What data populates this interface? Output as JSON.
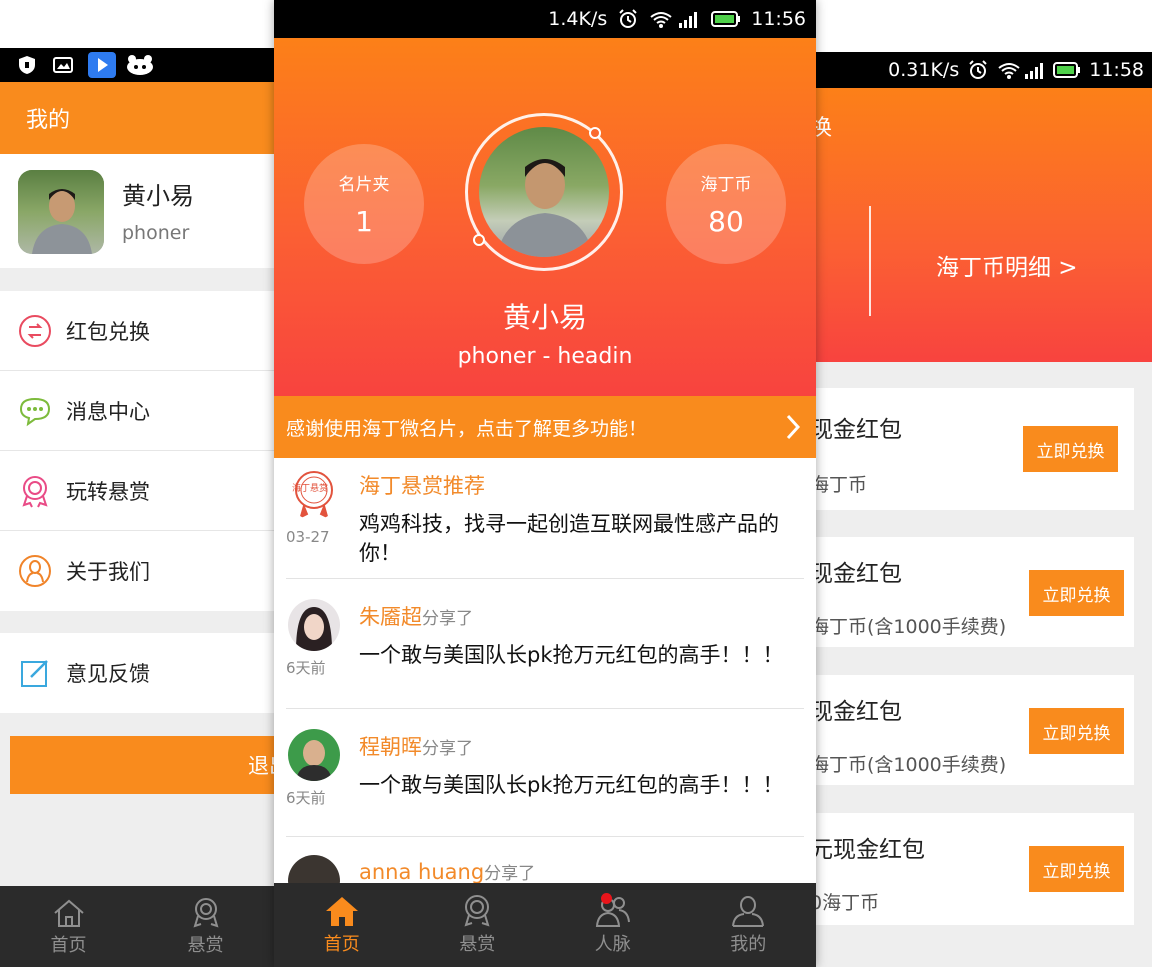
{
  "left": {
    "header_title": "我的",
    "profile": {
      "name": "黄小易",
      "subtitle": "phoner"
    },
    "menu": [
      {
        "label": "红包兑换",
        "icon": "exchange-icon"
      },
      {
        "label": "消息中心",
        "icon": "message-icon"
      },
      {
        "label": "玩转悬赏",
        "icon": "medal-icon"
      },
      {
        "label": "关于我们",
        "icon": "about-icon"
      }
    ],
    "feedback_label": "意见反馈",
    "logout_label": "退出",
    "tabs": [
      {
        "label": "首页",
        "icon": "home-icon"
      },
      {
        "label": "悬赏",
        "icon": "medal-icon"
      }
    ]
  },
  "middle": {
    "status": {
      "speed": "1.4K/s",
      "time": "11:56"
    },
    "stats": [
      {
        "label": "名片夹",
        "value": "1"
      },
      {
        "label": "海丁币",
        "value": "80"
      }
    ],
    "profile": {
      "name": "黄小易",
      "subtitle": "phoner - headin"
    },
    "banner": "感谢使用海丁微名片，点击了解更多功能！",
    "feed": [
      {
        "author": "海丁悬赏推荐",
        "shared": "",
        "date": "03-27",
        "text": "鸡鸡科技，找寻一起创造互联网最性感产品的你！",
        "badge": "海丁悬赏"
      },
      {
        "author": "朱靥超",
        "shared": "分享了",
        "date": "6天前",
        "text": "一个敢与美国队长pk抢万元红包的高手！！！"
      },
      {
        "author": "程朝晖",
        "shared": "分享了",
        "date": "6天前",
        "text": "一个敢与美国队长pk抢万元红包的高手！！！"
      },
      {
        "author": "anna huang",
        "shared": "分享了",
        "date": "",
        "text": ""
      }
    ],
    "tabs": [
      {
        "label": "首页",
        "icon": "home-icon",
        "active": true
      },
      {
        "label": "悬赏",
        "icon": "medal-icon"
      },
      {
        "label": "人脉",
        "icon": "contacts-icon",
        "badge": true
      },
      {
        "label": "我的",
        "icon": "person-icon"
      }
    ]
  },
  "right": {
    "status": {
      "speed": "0.31K/s",
      "time": "11:58"
    },
    "header_fragment": "换",
    "detail_link": "海丁币明细 >",
    "cards": [
      {
        "title": "现金红包",
        "sub": "海丁币",
        "button": "立即兑换"
      },
      {
        "title": "现金红包",
        "sub": "海丁币(含1000手续费)",
        "button": "立即兑换"
      },
      {
        "title": "现金红包",
        "sub": "海丁币(含1000手续费)",
        "button": "立即兑换"
      },
      {
        "title": "元现金红包",
        "sub": "0海丁币",
        "button": "立即兑换"
      }
    ]
  },
  "colors": {
    "accent": "#f98b1d",
    "gradient_top": "#fc8018",
    "gradient_bottom": "#f8433f",
    "tabbar": "#2b2b2b",
    "notification": "#e8151b"
  }
}
